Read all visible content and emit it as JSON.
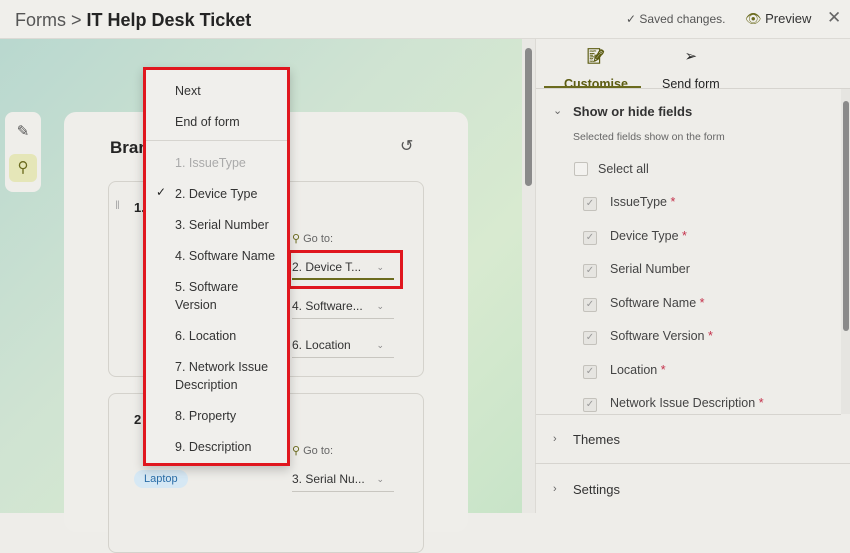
{
  "header": {
    "app": "Forms",
    "separator": ">",
    "title": "IT Help Desk Ticket",
    "saved": "Saved changes.",
    "preview": "Preview"
  },
  "card": {
    "title": "Bran",
    "card1_num": "1.",
    "card2_num": "2",
    "goto_label": "Go to:",
    "card1_dropdowns": [
      "2. Device T...",
      "4. Software...",
      "6. Location"
    ],
    "card2_dropdown": "3. Serial Nu...",
    "badge": "Laptop"
  },
  "menu": {
    "items": [
      "Next",
      "End of form",
      "1. IssueType",
      "2. Device Type",
      "3. Serial Number",
      "4. Software Name",
      "5. Software Version",
      "6. Location",
      "7. Network Issue Description",
      "8. Property",
      "9. Description"
    ],
    "selected": "2. Device Type"
  },
  "panel": {
    "tabs": [
      "Customise",
      "Send form"
    ],
    "section": "Show or hide fields",
    "hint": "Selected fields show on the form",
    "select_all": "Select all",
    "fields": [
      {
        "label": "IssueType",
        "req": "*"
      },
      {
        "label": "Device Type",
        "req": "*"
      },
      {
        "label": "Serial Number",
        "req": ""
      },
      {
        "label": "Software Name",
        "req": "*"
      },
      {
        "label": "Software Version",
        "req": "*"
      },
      {
        "label": "Location",
        "req": "*"
      },
      {
        "label": "Network Issue Description",
        "req": "*"
      }
    ],
    "themes": "Themes",
    "settings": "Settings"
  }
}
